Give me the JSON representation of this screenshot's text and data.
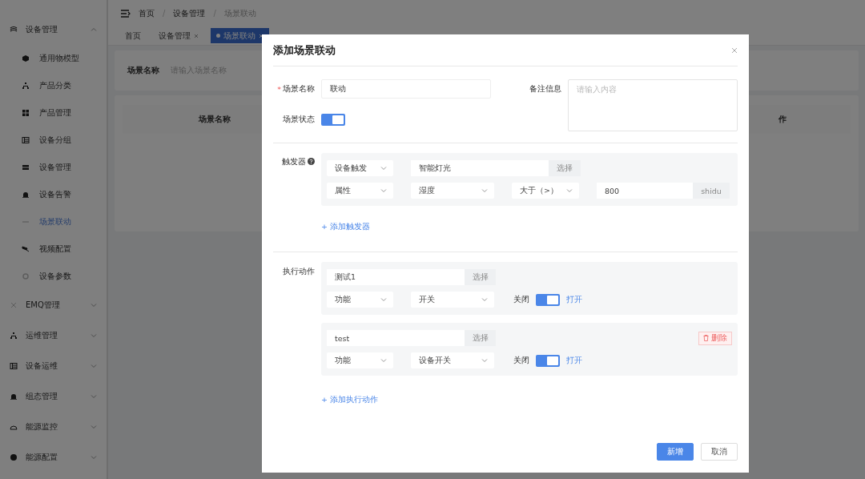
{
  "sidebar": {
    "groups": [
      {
        "label": "设备管理",
        "expanded": true,
        "children": [
          {
            "label": "通用物模型",
            "selected": false
          },
          {
            "label": "产品分类",
            "selected": false
          },
          {
            "label": "产品管理",
            "selected": false
          },
          {
            "label": "设备分组",
            "selected": false
          },
          {
            "label": "设备管理",
            "selected": false
          },
          {
            "label": "设备告警",
            "selected": false
          },
          {
            "label": "场景联动",
            "selected": true
          },
          {
            "label": "视频配置",
            "selected": false
          },
          {
            "label": "设备参数",
            "selected": false
          }
        ]
      },
      {
        "label": "EMQ管理",
        "expanded": false
      },
      {
        "label": "运维管理",
        "expanded": false
      },
      {
        "label": "设备运维",
        "expanded": false
      },
      {
        "label": "组态管理",
        "expanded": false
      },
      {
        "label": "能源监控",
        "expanded": false
      },
      {
        "label": "能源配置",
        "expanded": false
      }
    ]
  },
  "breadcrumb": [
    "首页",
    "设备管理",
    "场景联动"
  ],
  "breadcrumb_separator": "/",
  "tabs": [
    {
      "label": "首页",
      "selected": false,
      "closable": false
    },
    {
      "label": "设备管理",
      "selected": false,
      "closable": true
    },
    {
      "label": "场景联动",
      "selected": true,
      "closable": true
    }
  ],
  "search": {
    "label": "场景名称",
    "placeholder": "请输入场景名称"
  },
  "table": {
    "columns": [
      "场景名称"
    ],
    "column_2": "作"
  },
  "dialog": {
    "title": "添加场景联动",
    "name": {
      "label": "场景名称",
      "required_mark": "*",
      "value": "联动"
    },
    "remark": {
      "label": "备注信息",
      "placeholder": "请输入内容"
    },
    "status": {
      "label": "场景状态",
      "on": true
    },
    "trigger": {
      "label": "触发器",
      "items": [
        {
          "source": "设备触发",
          "device": "智能灯光",
          "pick": "选择",
          "kind": "属性",
          "property": "湿度",
          "operator": "大于（>）",
          "value": "800",
          "unit": "shidu"
        }
      ],
      "add": "+ 添加触发器"
    },
    "actions": {
      "label": "执行动作",
      "items": [
        {
          "device": "测试1",
          "pick": "选择",
          "kind": "功能",
          "target": "开关",
          "off_label": "关闭",
          "on_label": "打开",
          "on": true
        },
        {
          "device": "test",
          "pick": "选择",
          "kind": "功能",
          "target": "设备开关",
          "off_label": "关闭",
          "on_label": "打开",
          "on": true,
          "delete": "删除"
        }
      ],
      "add": "+ 添加执行动作"
    },
    "buttons": [
      {
        "label": "新增",
        "kind": "primary"
      },
      {
        "label": "取消",
        "kind": "default"
      }
    ]
  }
}
